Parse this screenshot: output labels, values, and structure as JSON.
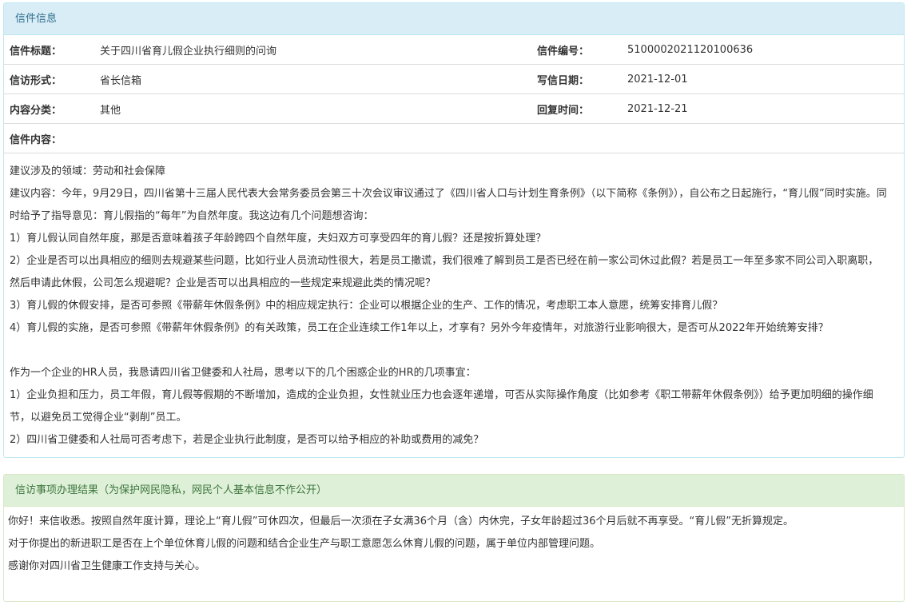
{
  "letter_panel": {
    "heading": "信件信息",
    "fields": {
      "title_label": "信件标题：",
      "title_value": "关于四川省育儿假企业执行细则的问询",
      "number_label": "信件编号：",
      "number_value": "5100002021120100636",
      "form_label": "信访形式：",
      "form_value": "省长信箱",
      "date_label": "写信日期：",
      "date_value": "2021-12-01",
      "category_label": "内容分类：",
      "category_value": "其他",
      "reply_time_label": "回复时间：",
      "reply_time_value": "2021-12-21",
      "content_label": "信件内容："
    },
    "content_paragraphs": [
      "建议涉及的领域：劳动和社会保障",
      "建议内容：今年，9月29日，四川省第十三届人民代表大会常务委员会第三十次会议审议通过了《四川省人口与计划生育条例》（以下简称《条例》），自公布之日起施行，“育儿假”同时实施。同时给予了指导意见：育儿假指的“每年”为自然年度。我这边有几个问题想咨询：",
      "1）育儿假认同自然年度，那是否意味着孩子年龄跨四个自然年度，夫妇双方可享受四年的育儿假？还是按折算处理？",
      "2）企业是否可以出具相应的细则去规避某些问题，比如行业人员流动性很大，若是员工撒谎，我们很难了解到员工是否已经在前一家公司休过此假？若是员工一年至多家不同公司入职离职，然后申请此休假，公司怎么规避呢？企业是否可以出具相应的一些规定来规避此类的情况呢？",
      "3）育儿假的休假安排，是否可参照《带薪年休假条例》中的相应规定执行：企业可以根据企业的生产、工作的情况，考虑职工本人意愿，统筹安排育儿假？",
      "4）育儿假的实施，是否可参照《带薪年休假条例》的有关政策，员工在企业连续工作1年以上，才享有？另外今年疫情年，对旅游行业影响很大，是否可从2022年开始统筹安排？",
      "",
      "作为一个企业的HR人员，我恳请四川省卫健委和人社局，思考以下的几个困惑企业的HR的几项事宜：",
      "1）企业负担和压力，员工年假，育儿假等假期的不断增加，造成的企业负担，女性就业压力也会逐年递增，可否从实际操作角度（比如参考《职工带薪年休假条例》）给予更加明细的操作细节，以避免员工觉得企业“剥削”员工。",
      "2）四川省卫健委和人社局可否考虑下，若是企业执行此制度，是否可以给予相应的补助或费用的减免？"
    ]
  },
  "result_panel": {
    "heading": "信访事项办理结果（为保护网民隐私，网民个人基本信息不作公开）",
    "paragraphs": [
      "你好！来信收悉。按照自然年度计算，理论上“育儿假”可休四次，但最后一次须在子女满36个月（含）内休完，子女年龄超过36个月后就不再享受。“育儿假”无折算规定。",
      "对于你提出的新进职工是否在上个单位休育儿假的问题和结合企业生产与职工意愿怎么休育儿假的问题，属于单位内部管理问题。",
      "感谢你对四川省卫生健康工作支持与关心。"
    ]
  }
}
